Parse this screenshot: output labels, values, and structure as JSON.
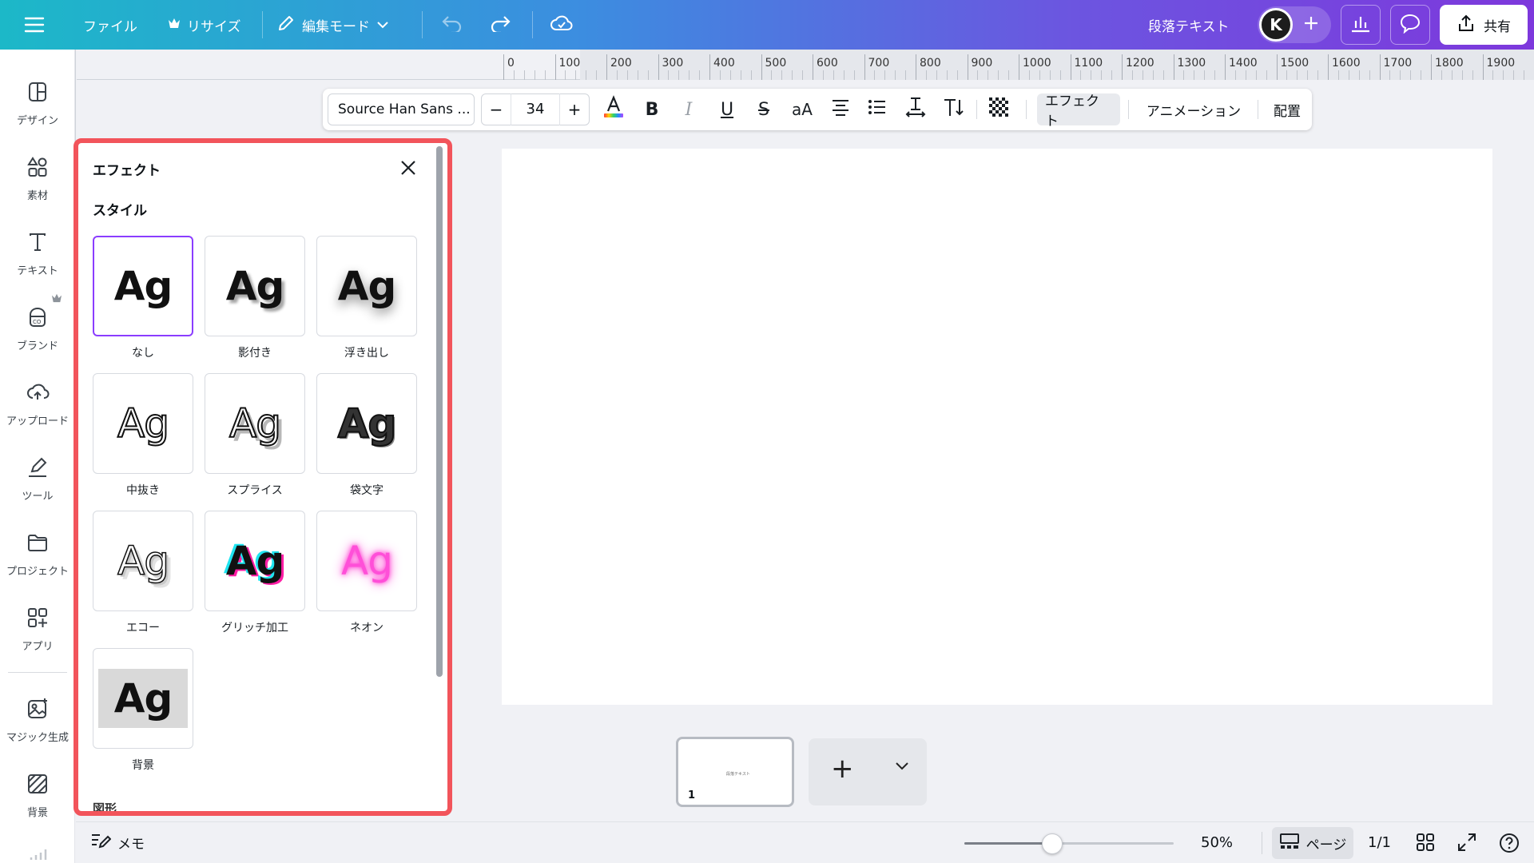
{
  "topbar": {
    "menu_icon": "hamburger-icon",
    "file": "ファイル",
    "resize": "リサイズ",
    "edit_mode": "編集モード",
    "doc_title": "段落テキスト",
    "share": "共有",
    "avatar_letter": "K"
  },
  "rail": {
    "items": [
      {
        "label": "デザイン",
        "icon": "design-icon"
      },
      {
        "label": "素材",
        "icon": "elements-icon"
      },
      {
        "label": "テキスト",
        "icon": "text-icon"
      },
      {
        "label": "ブランド",
        "icon": "brand-icon"
      },
      {
        "label": "アップロード",
        "icon": "upload-icon"
      },
      {
        "label": "ツール",
        "icon": "tools-icon"
      },
      {
        "label": "プロジェクト",
        "icon": "folder-icon"
      },
      {
        "label": "アプリ",
        "icon": "apps-icon"
      },
      {
        "label": "マジック生成",
        "icon": "magic-icon"
      },
      {
        "label": "背景",
        "icon": "background-icon"
      }
    ]
  },
  "ruler": {
    "labels": [
      "0",
      "100",
      "200",
      "300",
      "400",
      "500",
      "600",
      "700",
      "800",
      "900",
      "1000",
      "1100",
      "1200",
      "1300",
      "1400",
      "1500",
      "1600",
      "1700",
      "1800",
      "1900"
    ]
  },
  "text_toolbar": {
    "font": "Source Han Sans ...",
    "size": "34",
    "minus": "−",
    "plus": "+",
    "bold": "B",
    "italic": "I",
    "underline": "U",
    "strike": "S",
    "case": "aA",
    "effects": "エフェクト",
    "animation": "アニメーション",
    "position": "配置"
  },
  "effects_panel": {
    "title": "エフェクト",
    "style_heading": "スタイル",
    "next_heading": "図形",
    "sample": "Ag",
    "styles": [
      {
        "label": "なし",
        "selected": true
      },
      {
        "label": "影付き"
      },
      {
        "label": "浮き出し"
      },
      {
        "label": "中抜き"
      },
      {
        "label": "スプライス"
      },
      {
        "label": "袋文字"
      },
      {
        "label": "エコー"
      },
      {
        "label": "グリッチ加工"
      },
      {
        "label": "ネオン"
      },
      {
        "label": "背景"
      }
    ]
  },
  "pages": {
    "thumb_number": "1",
    "thumb_text": "段落テキスト",
    "add": "+"
  },
  "bottombar": {
    "memo": "メモ",
    "zoom_value": "50%",
    "zoom_fraction": 0.42,
    "pages_label": "ページ",
    "page_count": "1/1"
  }
}
